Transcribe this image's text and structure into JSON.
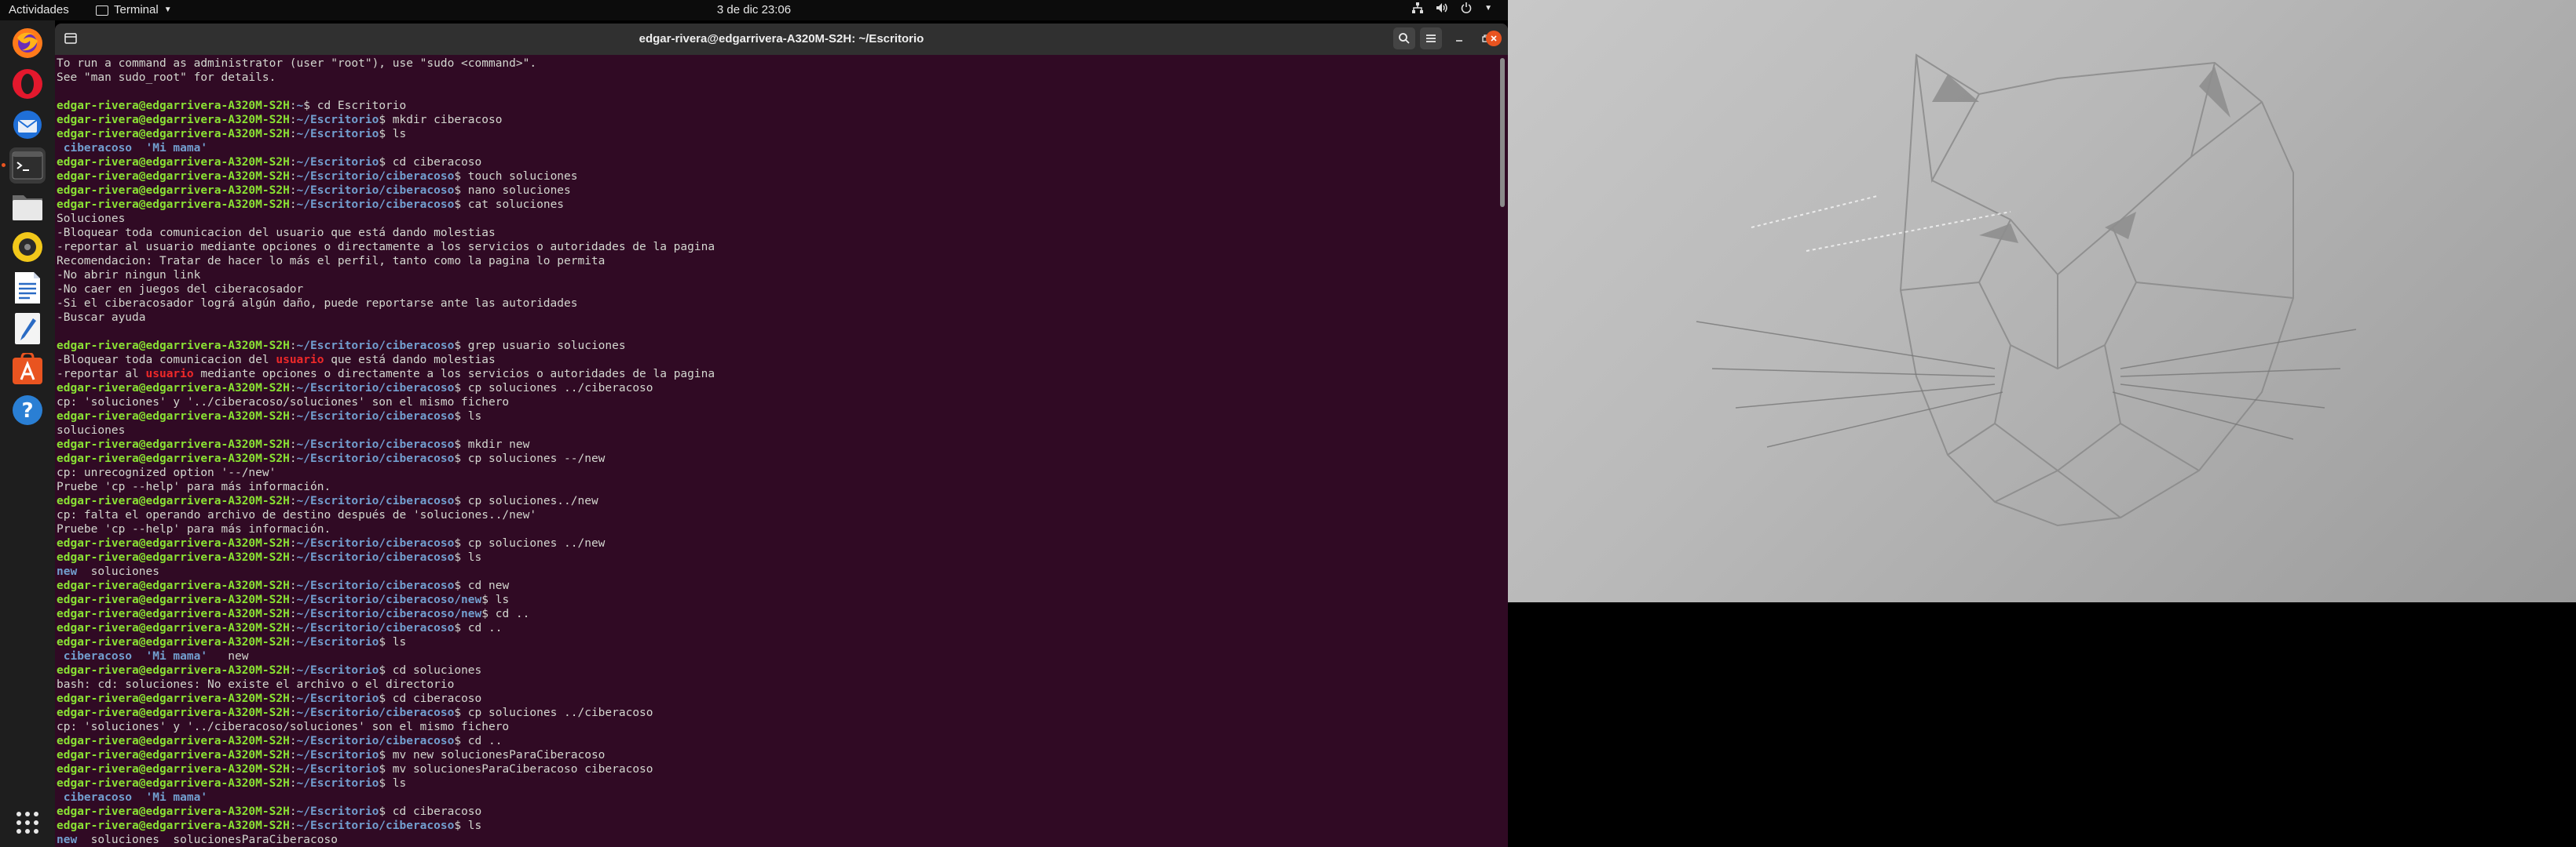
{
  "topbar": {
    "activities": "Actividades",
    "app_menu": "Terminal",
    "clock": "3 de dic  23:06"
  },
  "dock": {
    "items": [
      "firefox",
      "opera",
      "thunderbird",
      "terminal",
      "files",
      "rhythmbox",
      "libreoffice-writer",
      "text-editor",
      "software-center",
      "help",
      "show-applications"
    ]
  },
  "window": {
    "title": "edgar-rivera@edgarrivera-A320M-S2H: ~/Escritorio"
  },
  "colors": {
    "terminal_bg": "#300a24",
    "user_host": "#8ae234",
    "path": "#729fcf",
    "highlight": "#ef2929",
    "close_button": "#e95420"
  },
  "terminal": {
    "user": "edgar-rivera@edgarrivera-A320M-S2H",
    "lines": [
      {
        "t": "text",
        "v": "To run a command as administrator (user \"root\"), use \"sudo <command>\"."
      },
      {
        "t": "text",
        "v": "See \"man sudo_root\" for details."
      },
      {
        "t": "text",
        "v": ""
      },
      {
        "t": "prompt",
        "path": "~",
        "cmd": " cd Escritorio"
      },
      {
        "t": "prompt",
        "path": "~/Escritorio",
        "cmd": " mkdir ciberacoso"
      },
      {
        "t": "prompt",
        "path": "~/Escritorio",
        "cmd": " ls"
      },
      {
        "t": "ls",
        "items": [
          {
            "n": " ciberacoso",
            "d": true
          },
          {
            "n": "  'Mi mama'",
            "d": true
          }
        ]
      },
      {
        "t": "prompt",
        "path": "~/Escritorio",
        "cmd": " cd ciberacoso"
      },
      {
        "t": "prompt",
        "path": "~/Escritorio/ciberacoso",
        "cmd": " touch soluciones"
      },
      {
        "t": "prompt",
        "path": "~/Escritorio/ciberacoso",
        "cmd": " nano soluciones"
      },
      {
        "t": "prompt",
        "path": "~/Escritorio/ciberacoso",
        "cmd": " cat soluciones"
      },
      {
        "t": "text",
        "v": "Soluciones"
      },
      {
        "t": "text",
        "v": "-Bloquear toda comunicacion del usuario que está dando molestias"
      },
      {
        "t": "text",
        "v": "-reportar al usuario mediante opciones o directamente a los servicios o autoridades de la pagina"
      },
      {
        "t": "text",
        "v": "Recomendacion: Tratar de hacer lo más el perfil, tanto como la pagina lo permita"
      },
      {
        "t": "text",
        "v": "-No abrir ningun link"
      },
      {
        "t": "text",
        "v": "-No caer en juegos del ciberacosador"
      },
      {
        "t": "text",
        "v": "-Si el ciberacosador lográ algún daño, puede reportarse ante las autoridades"
      },
      {
        "t": "text",
        "v": "-Buscar ayuda"
      },
      {
        "t": "text",
        "v": ""
      },
      {
        "t": "prompt",
        "path": "~/Escritorio/ciberacoso",
        "cmd": " grep usuario soluciones"
      },
      {
        "t": "grep",
        "pre": "-Bloquear toda comunicacion del ",
        "m": "usuario",
        "post": " que está dando molestias"
      },
      {
        "t": "grep",
        "pre": "-reportar al ",
        "m": "usuario",
        "post": " mediante opciones o directamente a los servicios o autoridades de la pagina"
      },
      {
        "t": "prompt",
        "path": "~/Escritorio/ciberacoso",
        "cmd": " cp soluciones ../ciberacoso"
      },
      {
        "t": "text",
        "v": "cp: 'soluciones' y '../ciberacoso/soluciones' son el mismo fichero"
      },
      {
        "t": "prompt",
        "path": "~/Escritorio/ciberacoso",
        "cmd": " ls"
      },
      {
        "t": "text",
        "v": "soluciones"
      },
      {
        "t": "prompt",
        "path": "~/Escritorio/ciberacoso",
        "cmd": " mkdir new"
      },
      {
        "t": "prompt",
        "path": "~/Escritorio/ciberacoso",
        "cmd": " cp soluciones --/new"
      },
      {
        "t": "text",
        "v": "cp: unrecognized option '--/new'"
      },
      {
        "t": "text",
        "v": "Pruebe 'cp --help' para más información."
      },
      {
        "t": "prompt",
        "path": "~/Escritorio/ciberacoso",
        "cmd": " cp soluciones../new"
      },
      {
        "t": "text",
        "v": "cp: falta el operando archivo de destino después de 'soluciones../new'"
      },
      {
        "t": "text",
        "v": "Pruebe 'cp --help' para más información."
      },
      {
        "t": "prompt",
        "path": "~/Escritorio/ciberacoso",
        "cmd": " cp soluciones ../new"
      },
      {
        "t": "prompt",
        "path": "~/Escritorio/ciberacoso",
        "cmd": " ls"
      },
      {
        "t": "ls",
        "items": [
          {
            "n": "new",
            "d": true
          },
          {
            "n": "  soluciones",
            "d": false
          }
        ]
      },
      {
        "t": "prompt",
        "path": "~/Escritorio/ciberacoso",
        "cmd": " cd new"
      },
      {
        "t": "prompt",
        "path": "~/Escritorio/ciberacoso/new",
        "cmd": " ls"
      },
      {
        "t": "prompt",
        "path": "~/Escritorio/ciberacoso/new",
        "cmd": " cd .."
      },
      {
        "t": "prompt",
        "path": "~/Escritorio/ciberacoso",
        "cmd": " cd .."
      },
      {
        "t": "prompt",
        "path": "~/Escritorio",
        "cmd": " ls"
      },
      {
        "t": "ls",
        "items": [
          {
            "n": " ciberacoso",
            "d": true
          },
          {
            "n": "  'Mi mama'",
            "d": true
          },
          {
            "n": "   new",
            "d": false
          }
        ]
      },
      {
        "t": "prompt",
        "path": "~/Escritorio",
        "cmd": " cd soluciones"
      },
      {
        "t": "text",
        "v": "bash: cd: soluciones: No existe el archivo o el directorio"
      },
      {
        "t": "prompt",
        "path": "~/Escritorio",
        "cmd": " cd ciberacoso"
      },
      {
        "t": "prompt",
        "path": "~/Escritorio/ciberacoso",
        "cmd": " cp soluciones ../ciberacoso"
      },
      {
        "t": "text",
        "v": "cp: 'soluciones' y '../ciberacoso/soluciones' son el mismo fichero"
      },
      {
        "t": "prompt",
        "path": "~/Escritorio/ciberacoso",
        "cmd": " cd .."
      },
      {
        "t": "prompt",
        "path": "~/Escritorio",
        "cmd": " mv new solucionesParaCiberacoso"
      },
      {
        "t": "prompt",
        "path": "~/Escritorio",
        "cmd": " mv solucionesParaCiberacoso ciberacoso"
      },
      {
        "t": "prompt",
        "path": "~/Escritorio",
        "cmd": " ls"
      },
      {
        "t": "ls",
        "items": [
          {
            "n": " ciberacoso",
            "d": true
          },
          {
            "n": "  'Mi mama'",
            "d": true
          }
        ]
      },
      {
        "t": "prompt",
        "path": "~/Escritorio",
        "cmd": " cd ciberacoso"
      },
      {
        "t": "prompt",
        "path": "~/Escritorio/ciberacoso",
        "cmd": " ls"
      },
      {
        "t": "ls",
        "items": [
          {
            "n": "new",
            "d": true
          },
          {
            "n": "  soluciones  solucionesParaCiberacoso",
            "d": false
          }
        ]
      }
    ]
  }
}
